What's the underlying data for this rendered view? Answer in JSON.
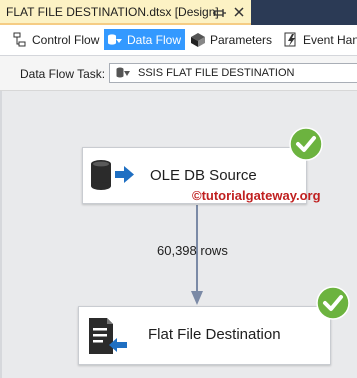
{
  "document_tab": {
    "title": "FLAT FILE DESTINATION.dtsx [Design]",
    "pin_icon": "pin-icon",
    "close_icon": "close-icon"
  },
  "designer_tabs": [
    {
      "label": "Control Flow",
      "icon": "control-flow-icon",
      "active": false
    },
    {
      "label": "Data Flow",
      "icon": "data-flow-icon",
      "active": true
    },
    {
      "label": "Parameters",
      "icon": "parameters-icon",
      "active": false
    },
    {
      "label": "Event Hand",
      "icon": "event-handlers-icon",
      "active": false
    }
  ],
  "task_selector": {
    "label": "Data Flow Task:",
    "value": "SSIS FLAT FILE DESTINATION",
    "icon": "data-flow-task-icon"
  },
  "canvas": {
    "source": {
      "name": "OLE DB Source",
      "icon": "database-source-icon",
      "status": "success-check"
    },
    "destination": {
      "name": "Flat File Destination",
      "icon": "flat-file-destination-icon",
      "status": "success-check"
    },
    "path_label": "60,398 rows",
    "watermark": "©tutorialgateway.org"
  },
  "colors": {
    "active_tab": "#3399ff",
    "document_tab": "#fcf2c4",
    "success": "#6cb33f",
    "path_arrow": "#7b8aa6",
    "watermark": "#c02020"
  }
}
